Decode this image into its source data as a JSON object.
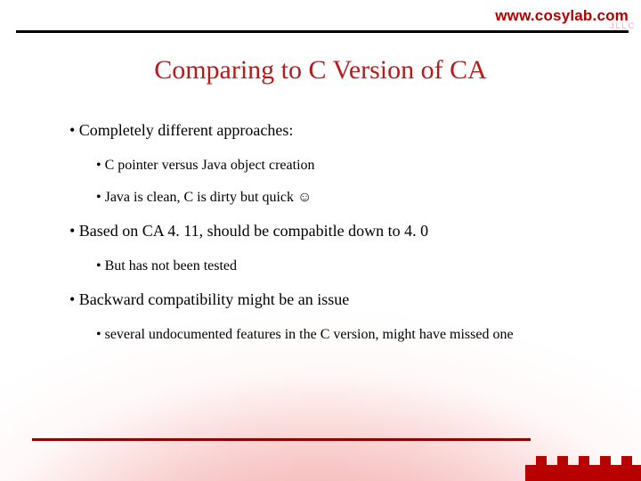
{
  "header": {
    "site": "www.cosylab.com",
    "code": "JLLC"
  },
  "title": "Comparing to C Version of CA",
  "bullets": {
    "b1": "• Completely different approaches:",
    "b1a": "• C pointer versus Java object creation",
    "b1b": "• Java is clean, C is dirty but quick ☺",
    "b2": "• Based on CA 4. 11, should be compabitle down to 4. 0",
    "b2a": "• But has not been tested",
    "b3": "• Backward compatibility might be an issue",
    "b3a": "• several undocumented features in the C version, might have missed one"
  }
}
